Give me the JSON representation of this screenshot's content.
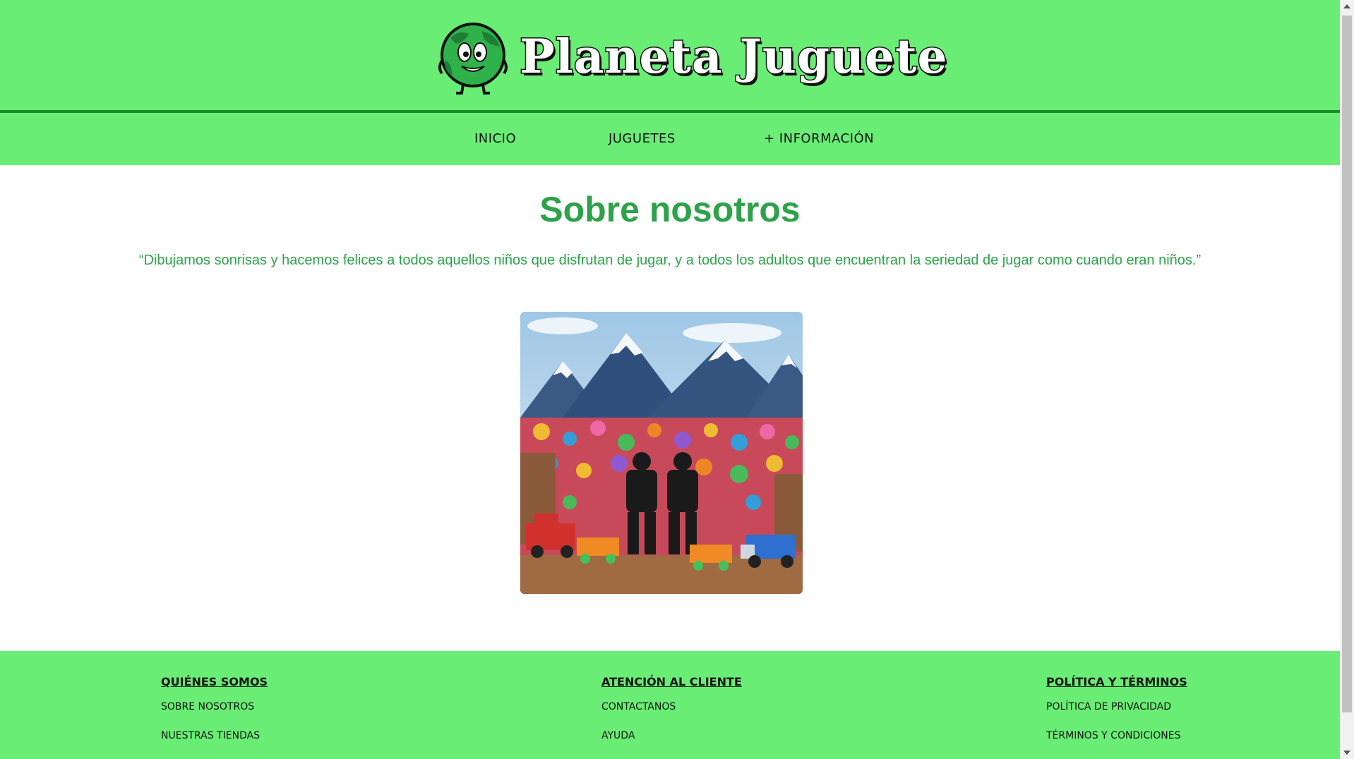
{
  "header": {
    "brand_title": "Planeta Juguete",
    "logo_icon": "globe-mascot-icon"
  },
  "nav": {
    "items": [
      {
        "label": "INICIO"
      },
      {
        "label": "JUGUETES"
      },
      {
        "label": "+ INFORMACIÓN"
      }
    ]
  },
  "main": {
    "title": "Sobre nosotros",
    "quote": "“Dibujamos sonrisas y hacemos felices a todos aquellos niños que disfrutan de jugar, y a todos los adultos que encuentran la seriedad de jugar como cuando eran niños.”",
    "hero_image": "toys-mountains-figures-image"
  },
  "footer": {
    "columns": [
      {
        "heading": "QUIÉNES SOMOS",
        "links": [
          "SOBRE NOSOTROS",
          "NUESTRAS TIENDAS"
        ]
      },
      {
        "heading": "ATENCIÓN AL CLIENTE",
        "links": [
          "CONTACTANOS",
          "AYUDA"
        ]
      },
      {
        "heading": "POLÍTICA Y TÉRMINOS",
        "links": [
          "POLÍTICA DE PRIVACIDAD",
          "TÉRMINOS Y CONDICIONES"
        ]
      }
    ]
  },
  "colors": {
    "green_bar": "#69ed75",
    "title_green": "#2ea24a",
    "header_border": "#1e8a2c"
  }
}
